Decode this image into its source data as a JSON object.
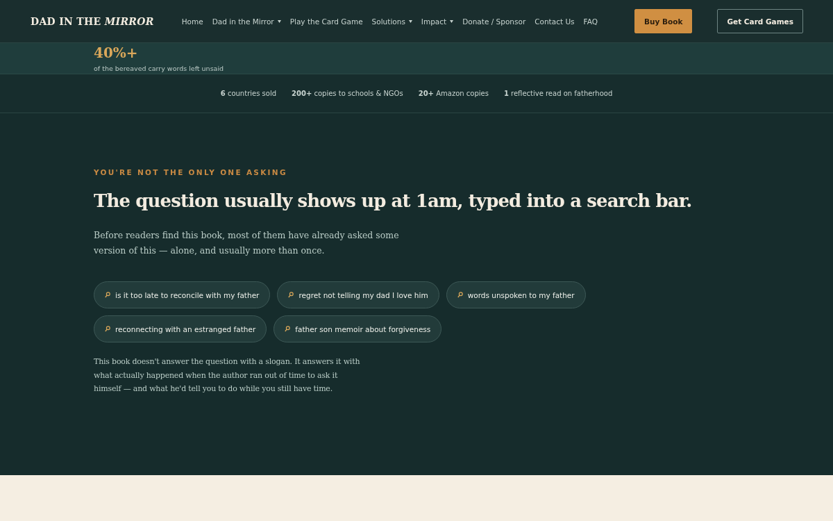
{
  "header": {
    "logo": "DAD IN THE *MIRROR*",
    "nav": [
      {
        "label": "Home",
        "has_menu": false
      },
      {
        "label": "Dad in the Mirror",
        "has_menu": true
      },
      {
        "label": "Play the Card Game",
        "has_menu": false
      },
      {
        "label": "Solutions",
        "has_menu": true
      },
      {
        "label": "Impact",
        "has_menu": true
      },
      {
        "label": "Donate / Sponsor",
        "has_menu": false
      },
      {
        "label": "Contact Us",
        "has_menu": false
      },
      {
        "label": "FAQ",
        "has_menu": false
      }
    ],
    "buttons": [
      {
        "label": "Buy Book",
        "kind": "primary"
      },
      {
        "label": "Get Card Games",
        "kind": "outline"
      }
    ]
  },
  "highlight_stat": {
    "value": "40%+",
    "caption": "of the bereaved carry words left unsaid"
  },
  "stats": [
    "**6** countries sold",
    "**200+** copies to schools & NGOs",
    "**20+** Amazon copies",
    "**1** reflective read on fatherhood"
  ],
  "section": {
    "eyebrow": "YOU'RE NOT THE ONLY ONE ASKING",
    "heading": "The question usually shows up at 1am, typed into a search bar.",
    "intro": "Before readers find this book, most of them have already asked some version of this — alone, and usually more than once.",
    "searches": [
      "is it too late to reconcile with my father",
      "regret not telling my dad I love him",
      "words unspoken to my father",
      "reconnecting with an estranged father",
      "father son memoir about forgiveness"
    ],
    "closing": "This book doesn't answer the question with a slogan. It answers it with what actually happened when the author ran out of time to ask it himself — and what he'd tell you to do while you still have time."
  }
}
